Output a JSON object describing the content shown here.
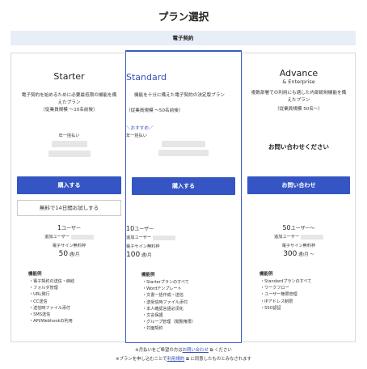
{
  "page": {
    "title": "プラン選択"
  },
  "section": {
    "label": "電子契約"
  },
  "plans": [
    {
      "name": "Starter",
      "desc": "電子契約を始めるために必要最低限の機能を備えたプラン",
      "scale": "（従業員規模 〜10名前後）",
      "fee_label": "年一括払い",
      "button": "購入する",
      "trial": "無料で14日間お試しする",
      "users_num": "1",
      "users_unit": "ユーザー",
      "add_users": "追加ユーザー",
      "free_sign_label": "電子サイン無料枠",
      "free_sign_num": "50",
      "free_sign_unit": "通/月",
      "func_title": "機能例",
      "functions": [
        "電子契約の送信・締結",
        "フォルダ管理",
        "URL発行",
        "CC送信",
        "送信時ファイル添付",
        "SMS送信",
        "API/Webhookの利用"
      ]
    },
    {
      "name": "Standard",
      "desc": "機能を十分に備えた電子契約の決定版プラン",
      "scale": "（従業員規模 〜50名前後）",
      "recommend": "＼おすすめ／",
      "fee_label": "年一括払い",
      "button": "購入する",
      "users_num": "10",
      "users_unit": "ユーザー",
      "add_users": "追加ユーザー",
      "free_sign_label": "電子サイン無料枠",
      "free_sign_num": "100",
      "free_sign_unit": "通/月",
      "func_title": "機能例",
      "functions": [
        "Starterプランのすべて",
        "Wordテンプレート",
        "文書一括作成・送信",
        "送受信時ファイル添付",
        "本人確認言語必須化",
        "文言保護",
        "グループ管理（閲覧権限）",
        "対面契約"
      ]
    },
    {
      "name": "Advance",
      "subname": "& Enterprise",
      "desc": "複数部署での利用にも適した内部統制機能を備えたプラン",
      "scale": "（従業員規模 50名〜）",
      "contact_text": "お問い合わせください",
      "button": "お問い合わせ",
      "users_num": "50",
      "users_unit": "ユーザー〜",
      "add_users": "追加ユーザー",
      "free_sign_label": "電子サイン無料枠",
      "free_sign_num": "300",
      "free_sign_unit": "通/月 〜",
      "func_title": "機能例",
      "functions": [
        "Standardプランのすべて",
        "ワークフロー",
        "ユーザー権限管理",
        "IPアドレス制限",
        "SSO認証"
      ]
    }
  ],
  "footer": {
    "line1_pre": "※月払いをご希望の方は",
    "line1_link": "お問い合わせ",
    "line1_post": "ください",
    "line2_pre": "※プランを申し込むことで",
    "line2_link": "利用規約",
    "line2_post": "に同意したものとみなされます"
  }
}
